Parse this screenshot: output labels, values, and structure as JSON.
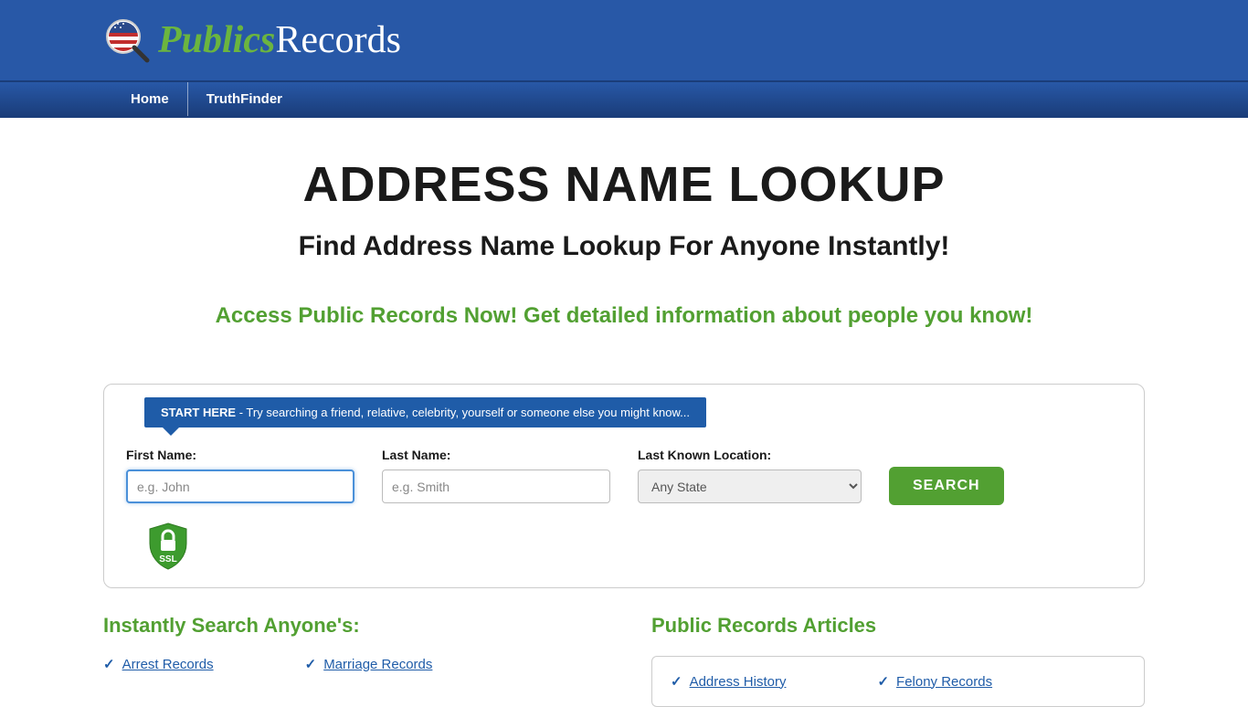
{
  "logo": {
    "text1": "Publics",
    "text2": "Records"
  },
  "nav": {
    "items": [
      {
        "label": "Home"
      },
      {
        "label": "TruthFinder"
      }
    ]
  },
  "hero": {
    "title": "ADDRESS NAME LOOKUP",
    "subtitle": "Find Address Name Lookup For Anyone Instantly!",
    "tagline": "Access Public Records Now! Get detailed information about people you know!"
  },
  "search": {
    "start_here_bold": "START HERE",
    "start_here_rest": " - Try searching a friend, relative, celebrity, yourself or someone else you might know...",
    "first_name_label": "First Name:",
    "first_name_placeholder": "e.g. John",
    "last_name_label": "Last Name:",
    "last_name_placeholder": "e.g. Smith",
    "location_label": "Last Known Location:",
    "location_value": "Any State",
    "button": "SEARCH",
    "ssl_label": "SSL"
  },
  "left_section": {
    "title": "Instantly Search Anyone's:",
    "col1": [
      {
        "label": "Arrest Records"
      }
    ],
    "col2": [
      {
        "label": "Marriage Records"
      }
    ]
  },
  "right_section": {
    "title": "Public Records Articles",
    "col1": [
      {
        "label": "Address History"
      }
    ],
    "col2": [
      {
        "label": "Felony Records"
      }
    ]
  }
}
